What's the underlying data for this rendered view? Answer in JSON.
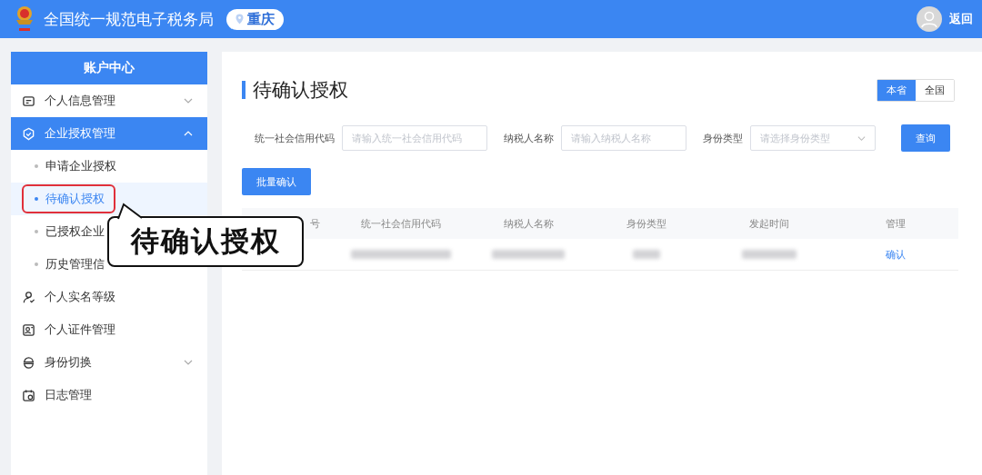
{
  "header": {
    "title": "全国统一规范电子税务局",
    "region": "重庆",
    "back": "返回"
  },
  "sidebar": {
    "title": "账户中心",
    "items": [
      {
        "label": "个人信息管理",
        "kind": "submenu",
        "expanded": false,
        "selected": false
      },
      {
        "label": "企业授权管理",
        "kind": "submenu",
        "expanded": true,
        "selected": true,
        "children": [
          {
            "label": "申请企业授权",
            "selected": false,
            "highlighted": false
          },
          {
            "label": "待确认授权",
            "selected": true,
            "highlighted": true
          },
          {
            "label": "已授权企业",
            "selected": false,
            "highlighted": false
          },
          {
            "label": "历史管理信",
            "selected": false,
            "highlighted": false
          }
        ]
      },
      {
        "label": "个人实名等级",
        "kind": "item",
        "selected": false
      },
      {
        "label": "个人证件管理",
        "kind": "item",
        "selected": false
      },
      {
        "label": "身份切换",
        "kind": "submenu",
        "expanded": false,
        "selected": false
      },
      {
        "label": "日志管理",
        "kind": "item",
        "selected": false
      }
    ]
  },
  "page": {
    "title": "待确认授权",
    "scope": [
      {
        "label": "本省",
        "selected": true
      },
      {
        "label": "全国",
        "selected": false
      }
    ],
    "filters": [
      {
        "label": "统一社会信用代码",
        "placeholder": "请输入统一社会信用代码",
        "kind": "input"
      },
      {
        "label": "纳税人名称",
        "placeholder": "请输入纳税人名称",
        "kind": "input"
      },
      {
        "label": "身份类型",
        "placeholder": "请选择身份类型",
        "kind": "select"
      }
    ],
    "search_button": "查询",
    "batch_button": "批量确认",
    "table": {
      "columns": [
        "号",
        "统一社会信用代码",
        "纳税人名称",
        "身份类型",
        "发起时间",
        "管理"
      ],
      "rows": [
        {
          "action": "确认"
        }
      ]
    }
  },
  "callout": {
    "text": "待确认授权"
  }
}
